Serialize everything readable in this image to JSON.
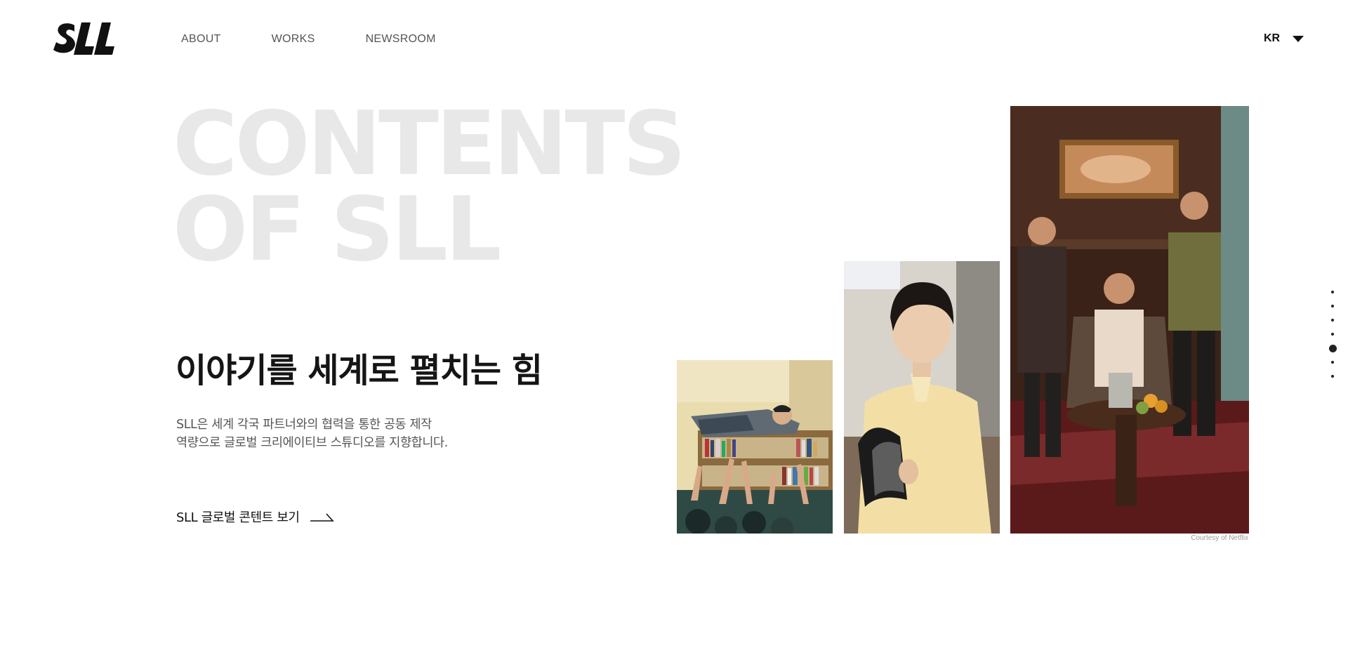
{
  "header": {
    "logo_text": "SLL",
    "nav": [
      {
        "label": "ABOUT"
      },
      {
        "label": "WORKS"
      },
      {
        "label": "NEWSROOM"
      }
    ],
    "language": "KR"
  },
  "hero": {
    "title_line1": "CONTENTS",
    "title_line2": "OF SLL",
    "headline": "이야기를 세계로 펼치는 힘",
    "description_line1": "SLL은 세계 각국 파트너와의 협력을 통한 공동 제작",
    "description_line2": "역량으로 글로벌 크리에이티브 스튜디오를 지향합니다.",
    "cta_label": "SLL 글로벌 콘텐트 보기"
  },
  "images": [
    {
      "name": "school-library-scene"
    },
    {
      "name": "young-man-reading-scene"
    },
    {
      "name": "men-in-salon-scene"
    }
  ],
  "credit": "Courtesy of Netflix",
  "pagination": {
    "total": 7,
    "active_index": 4
  },
  "colors": {
    "accent_text": "#111111",
    "hero_title_gray": "#e8e8e8",
    "nav_gray": "#555555"
  }
}
